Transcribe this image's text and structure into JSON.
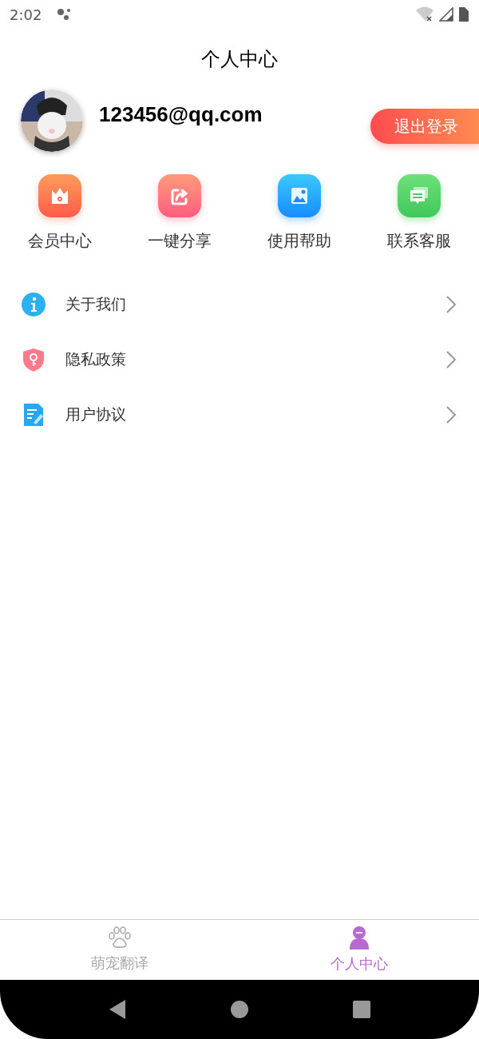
{
  "status_bar": {
    "time": "2:02"
  },
  "header": {
    "title": "个人中心"
  },
  "profile": {
    "email": "123456@qq.com",
    "logout_button": "退出登录"
  },
  "shortcuts": [
    {
      "label": "会员中心"
    },
    {
      "label": "一键分享"
    },
    {
      "label": "使用帮助"
    },
    {
      "label": "联系客服"
    }
  ],
  "menu": [
    {
      "label": "关于我们"
    },
    {
      "label": "隐私政策"
    },
    {
      "label": "用户协议"
    }
  ],
  "tab_bar": [
    {
      "label": "萌宠翻译",
      "selected": false
    },
    {
      "label": "个人中心",
      "selected": true
    }
  ]
}
